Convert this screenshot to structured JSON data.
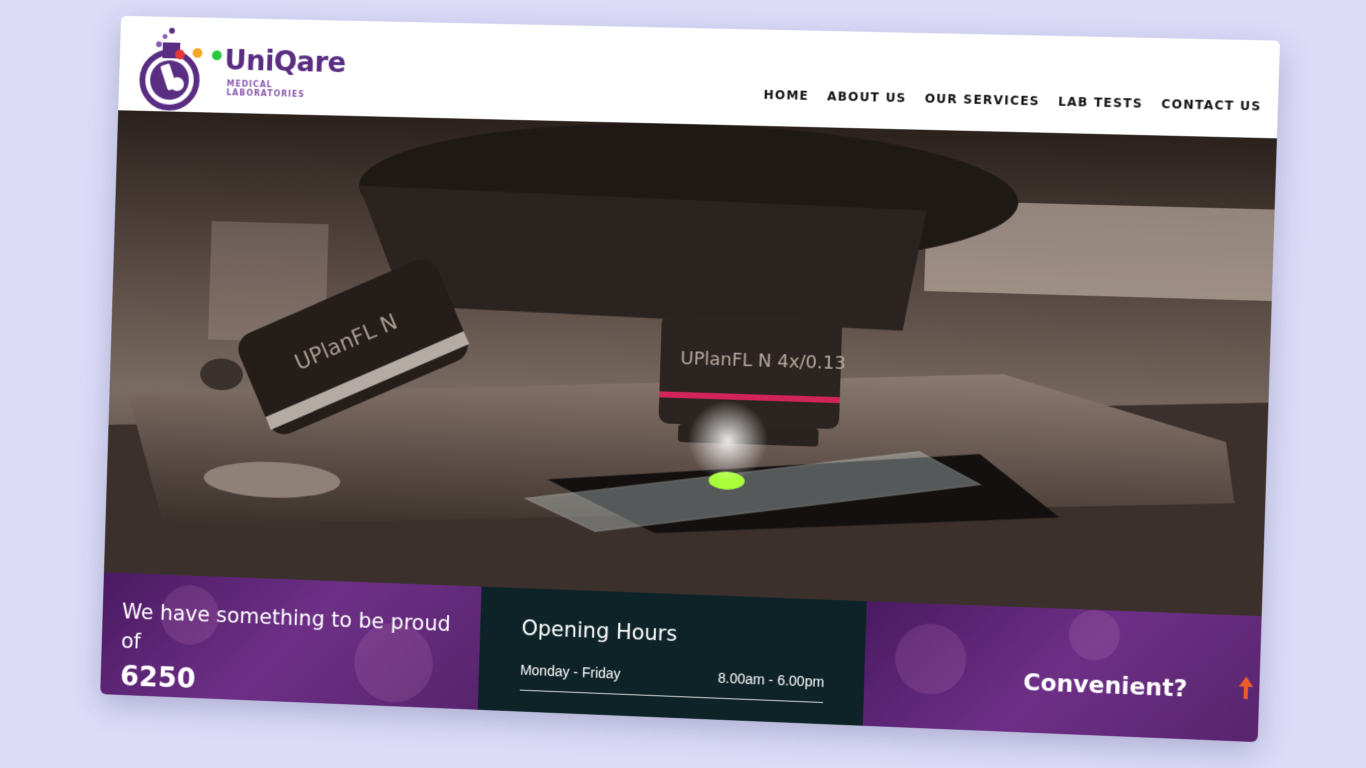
{
  "brand": {
    "name": "UniQare",
    "tagline": "MEDICAL LABORATORIES",
    "colors": {
      "primary": "#5a2d82",
      "accent": "#8a5cae",
      "dark_panel": "#0e2328"
    }
  },
  "nav": {
    "items": [
      {
        "label": "HOME"
      },
      {
        "label": "ABOUT US"
      },
      {
        "label": "OUR SERVICES"
      },
      {
        "label": "LAB TESTS"
      },
      {
        "label": "CONTACT US"
      }
    ]
  },
  "hero": {
    "image": "microscope-photo",
    "objective_1_text": "UPlanFL N",
    "objective_2_text": "UPlanFL N 4x/0.13"
  },
  "stats": {
    "title": "We have something to be proud of",
    "number": "6250"
  },
  "hours": {
    "title": "Opening Hours",
    "rows": [
      {
        "days": "Monday - Friday",
        "time": "8.00am - 6.00pm"
      }
    ]
  },
  "promo": {
    "title": "Convenient?"
  },
  "icons": {
    "scroll_top": "arrow-up-icon"
  }
}
